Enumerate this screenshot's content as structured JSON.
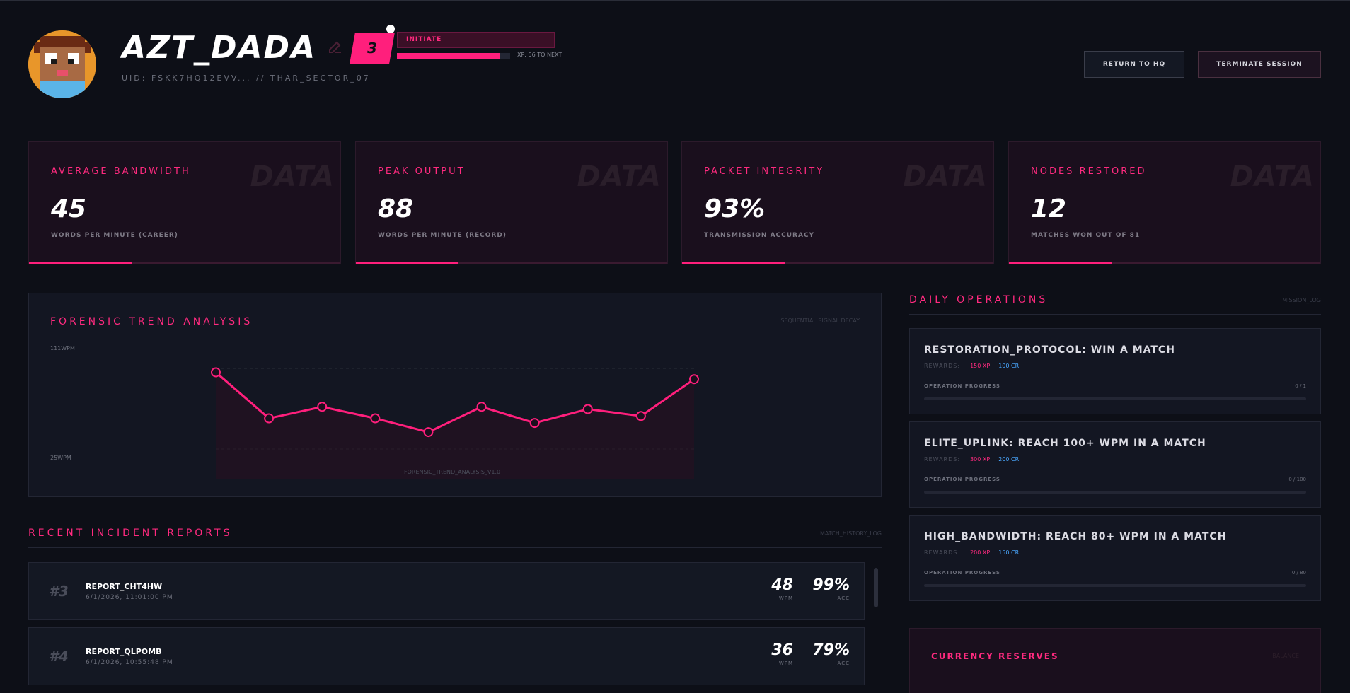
{
  "header": {
    "username": "AZT_DADA",
    "uid": "UID: FSKK7HQ12EVV... // THAR_SECTOR_07",
    "level": "3",
    "rank": "INITIATE",
    "xp_progress": 0.91,
    "xp_text": "XP: 56 TO NEXT",
    "buttons": {
      "return": "RETURN TO HQ",
      "terminate": "TERMINATE SESSION"
    }
  },
  "stats": [
    {
      "label": "AVERAGE BANDWIDTH",
      "value": "45",
      "sub": "WORDS PER MINUTE (CAREER)",
      "watermark": "DATA"
    },
    {
      "label": "PEAK OUTPUT",
      "value": "88",
      "sub": "WORDS PER MINUTE (RECORD)",
      "watermark": "DATA"
    },
    {
      "label": "PACKET INTEGRITY",
      "value": "93%",
      "sub": "TRANSMISSION ACCURACY",
      "watermark": "DATA"
    },
    {
      "label": "NODES RESTORED",
      "value": "12",
      "sub": "MATCHES WON OUT OF 81",
      "watermark": "DATA"
    }
  ],
  "chart_panel": {
    "title": "FORENSIC TREND ANALYSIS",
    "meta": "SEQUENTIAL SIGNAL DECAY",
    "footer": "FORENSIC_TREND_ANALYSIS_V1.0"
  },
  "chart_data": {
    "type": "line",
    "x": [
      1,
      2,
      3,
      4,
      5,
      6,
      7,
      8,
      9,
      10
    ],
    "values": [
      88,
      48,
      58,
      48,
      36,
      58,
      44,
      56,
      50,
      82
    ],
    "ylabel_top": "111WPM",
    "ylabel_bottom": "25WPM",
    "ylim": [
      25,
      111
    ],
    "grid": true
  },
  "reports": {
    "title": "RECENT INCIDENT REPORTS",
    "meta": "MATCH_HISTORY_LOG",
    "items": [
      {
        "rank": "#3",
        "id": "REPORT_CHT4HW",
        "date": "6/1/2026, 11:01:00 PM",
        "wpm": "48",
        "wpm_unit": "WPM",
        "acc": "99%",
        "acc_unit": "ACC"
      },
      {
        "rank": "#4",
        "id": "REPORT_QLPOMB",
        "date": "6/1/2026, 10:55:48 PM",
        "wpm": "36",
        "wpm_unit": "WPM",
        "acc": "79%",
        "acc_unit": "ACC"
      }
    ]
  },
  "operations": {
    "title": "DAILY OPERATIONS",
    "meta": "MISSION_LOG",
    "rewards_label": "REWARDS:",
    "progress_label": "OPERATION PROGRESS",
    "items": [
      {
        "title": "RESTORATION_PROTOCOL: WIN A MATCH",
        "xp": "150 XP",
        "cr": "100 CR",
        "count": "0 / 1"
      },
      {
        "title": "ELITE_UPLINK: REACH 100+ WPM IN A MATCH",
        "xp": "300 XP",
        "cr": "200 CR",
        "count": "0 / 100"
      },
      {
        "title": "HIGH_BANDWIDTH: REACH 80+ WPM IN A MATCH",
        "xp": "200 XP",
        "cr": "150 CR",
        "count": "0 / 80"
      }
    ]
  },
  "currency": {
    "title": "CURRENCY RESERVES",
    "meta": "BALANCE"
  },
  "colors": {
    "accent": "#ff1f7c",
    "background": "#0d0f17",
    "credit": "#4aa8ff"
  }
}
